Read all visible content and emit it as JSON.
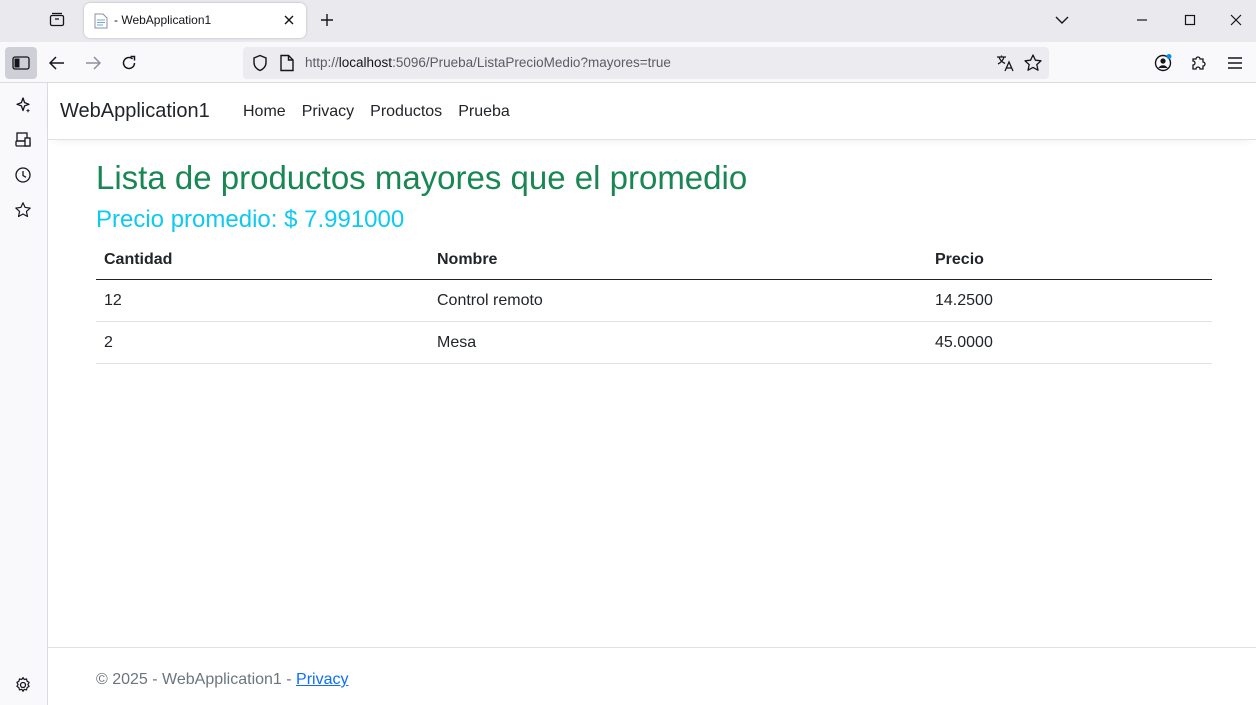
{
  "browser": {
    "tab_title": "- WebApplication1",
    "url_prefix": "http://",
    "url_host": "localhost",
    "url_rest": ":5096/Prueba/ListaPrecioMedio?mayores=true"
  },
  "site": {
    "brand": "WebApplication1",
    "nav": [
      "Home",
      "Privacy",
      "Productos",
      "Prueba"
    ]
  },
  "main": {
    "title": "Lista de productos mayores que el promedio",
    "average_label": "Precio promedio: $ 7.991000",
    "table": {
      "headers": [
        "Cantidad",
        "Nombre",
        "Precio"
      ],
      "rows": [
        [
          "12",
          "Control remoto",
          "14.2500"
        ],
        [
          "2",
          "Mesa",
          "45.0000"
        ]
      ]
    }
  },
  "footer": {
    "text": "© 2025 - WebApplication1 - ",
    "link": "Privacy"
  },
  "colors": {
    "title": "#198754",
    "average": "#0dcaf0",
    "link": "#0d6efd"
  }
}
